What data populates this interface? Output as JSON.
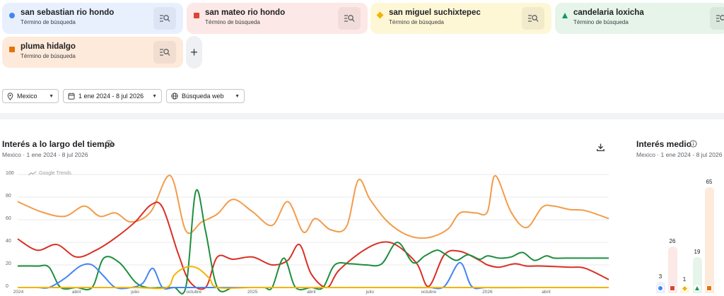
{
  "terms": [
    {
      "term": "san sebastian rio hondo",
      "sub": "Término de búsqueda",
      "color": "#4285f4",
      "bg": "#e8f0fe",
      "btn": "#dde5f5",
      "icon": "circle"
    },
    {
      "term": "san mateo rio hondo",
      "sub": "Término de búsqueda",
      "color": "#db4437",
      "bg": "#fce8e6",
      "btn": "#f1dcd9",
      "icon": "square"
    },
    {
      "term": "san miguel suchixtepec",
      "sub": "Término de búsqueda",
      "color": "#f4b400",
      "bg": "#fef7d6",
      "btn": "#f1eacb",
      "icon": "diamond"
    },
    {
      "term": "candelaria loxicha",
      "sub": "Término de búsqueda",
      "color": "#0f9d58",
      "bg": "#e6f4ea",
      "btn": "#d9e8dd",
      "icon": "triangle"
    },
    {
      "term": "pluma hidalgo",
      "sub": "Término de búsqueda",
      "color": "#e8710a",
      "bg": "#feeadb",
      "btn": "#f2ded0",
      "icon": "square"
    }
  ],
  "add_label": "+",
  "filters": {
    "region": "Mexico",
    "date_range": "1 ene 2024 - 8 jul 2026",
    "search_type": "Búsqueda web"
  },
  "interest_over_time": {
    "title": "Interés a lo largo del tiempo",
    "subtitle": "Mexico · 1 ene 2024 - 8 jul 2026",
    "watermark": "Google Trends"
  },
  "average_interest": {
    "title": "Interés medio",
    "subtitle": "Mexico · 1 ene 2024 - 8 jul 2026"
  },
  "chart_data": [
    {
      "type": "line",
      "ylim": [
        0,
        100
      ],
      "yticks": [
        "0",
        "20",
        "40",
        "60",
        "80",
        "100"
      ],
      "x_ticks": [
        "2024",
        "abril",
        "julio",
        "octubre",
        "2025",
        "abril",
        "julio",
        "octubre",
        "2026",
        "abril"
      ],
      "x_tick_months": [
        0,
        3,
        6,
        9,
        12,
        15,
        18,
        21,
        24,
        27
      ],
      "x_range_months": [
        0,
        30.2
      ],
      "series": [
        {
          "name": "pluma hidalgo",
          "color": "#f29c4a",
          "x": [
            0,
            1.2,
            2.4,
            3.4,
            4.2,
            5,
            5.8,
            6.8,
            7.8,
            8.6,
            9.4,
            10.2,
            11,
            12,
            13,
            13.8,
            14.6,
            15.2,
            16,
            16.8,
            17.4,
            18,
            18.8,
            19.6,
            20.4,
            21.2,
            22,
            22.6,
            23.4,
            24,
            24.4,
            25.2,
            26,
            26.8,
            27.4,
            28.2,
            29,
            30.2
          ],
          "y": [
            76,
            67,
            63,
            72,
            63,
            66,
            58,
            67,
            99,
            50,
            58,
            65,
            78,
            67,
            55,
            76,
            49,
            61,
            51,
            54,
            95,
            78,
            60,
            49,
            44,
            45,
            52,
            66,
            66,
            67,
            99,
            67,
            53,
            71,
            72,
            69,
            68,
            61
          ]
        },
        {
          "name": "san mateo rio hondo",
          "color": "#d93025",
          "x": [
            0,
            1,
            2,
            3,
            4,
            5,
            6,
            6.8,
            7.4,
            8.2,
            8.8,
            9.6,
            10.2,
            11,
            12,
            13,
            13.8,
            14.4,
            15,
            15.8,
            16.4,
            17.6,
            18.6,
            19.4,
            20.4,
            21,
            21.8,
            22.6,
            23.6,
            24,
            24.6,
            25.4,
            26,
            26.8,
            28.2,
            29,
            30.2
          ],
          "y": [
            43,
            33,
            38,
            27,
            33,
            44,
            58,
            73,
            71,
            30,
            5,
            0,
            27,
            25,
            27,
            20,
            24,
            38,
            12,
            0,
            15,
            32,
            40,
            37,
            21,
            1,
            29,
            32,
            24,
            20,
            18,
            21,
            19,
            19,
            18,
            17,
            7
          ]
        },
        {
          "name": "candelaria loxicha",
          "color": "#1e8e3e",
          "x": [
            0,
            1,
            1.6,
            2.2,
            3,
            3.8,
            4.4,
            5.2,
            6,
            6.6,
            7.4,
            8,
            8.6,
            9.1,
            9.6,
            10.2,
            11,
            11.6,
            12,
            12.6,
            13,
            13.6,
            14.2,
            15,
            15.6,
            16.2,
            17,
            17.8,
            18.6,
            19.4,
            20.2,
            20.8,
            21.4,
            21.8,
            22.4,
            23,
            23.6,
            24,
            24.6,
            25.2,
            25.8,
            26.4,
            27,
            27.4,
            28,
            29,
            30.2
          ],
          "y": [
            19,
            19,
            18,
            0,
            0,
            0,
            26,
            22,
            5,
            0,
            0,
            0,
            1,
            85,
            50,
            0,
            0,
            0,
            0,
            0,
            0,
            26,
            0,
            0,
            0,
            20,
            21,
            20,
            21,
            40,
            22,
            28,
            33,
            30,
            24,
            29,
            25,
            28,
            26,
            27,
            31,
            24,
            28,
            26,
            26,
            26,
            26
          ]
        },
        {
          "name": "san sebastian rio hondo",
          "color": "#4285f4",
          "x": [
            0,
            1,
            1.6,
            2.4,
            3.2,
            3.8,
            4.4,
            5,
            5.8,
            6.4,
            6.9,
            7.4,
            8,
            9,
            10,
            12,
            14,
            16,
            18,
            20,
            21,
            21.8,
            22.6,
            23.2,
            24,
            26,
            28,
            30.2
          ],
          "y": [
            0,
            0,
            0,
            8,
            19,
            20,
            10,
            0,
            0,
            4,
            17,
            0,
            0,
            0,
            0,
            0,
            0,
            0,
            0,
            0,
            0,
            1,
            22,
            1,
            0,
            0,
            0,
            0
          ]
        },
        {
          "name": "san miguel suchixtepec",
          "color": "#f4b400",
          "x": [
            0,
            2,
            4,
            6,
            7.6,
            8,
            8.6,
            9.2,
            9.8,
            10.2,
            12,
            14,
            16,
            18,
            20,
            22,
            24,
            26,
            28,
            30.2
          ],
          "y": [
            0,
            0,
            0,
            0,
            0,
            11,
            18,
            17,
            8,
            0,
            0,
            0,
            0,
            0,
            0,
            0,
            0,
            0,
            0,
            0
          ]
        }
      ]
    },
    {
      "type": "bar",
      "categories": [
        "san sebastian rio hondo",
        "san mateo rio hondo",
        "san miguel suchixtepec",
        "candelaria loxicha",
        "pluma hidalgo"
      ],
      "values": [
        3,
        26,
        1,
        19,
        65
      ],
      "colors": [
        "#4285f4",
        "#db4437",
        "#f4b400",
        "#0f9d58",
        "#e8710a"
      ],
      "bg_colors": [
        "#e8f0fe",
        "#fce8e6",
        "#fef7d6",
        "#e6f4ea",
        "#feeadb"
      ]
    }
  ]
}
